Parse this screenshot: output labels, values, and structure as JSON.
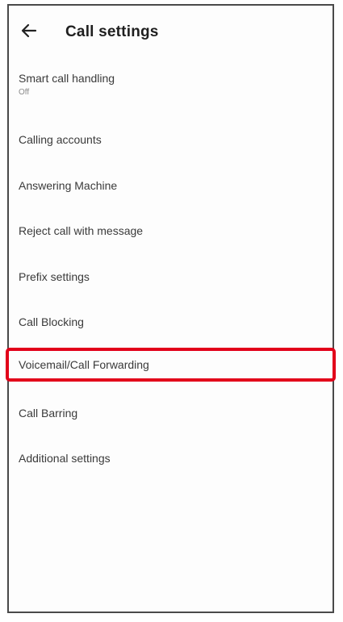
{
  "header": {
    "back_icon": "back-arrow-icon",
    "title": "Call settings"
  },
  "settings": {
    "items": [
      {
        "label": "Smart call handling",
        "sub": "Off"
      },
      {
        "label": "Calling accounts"
      },
      {
        "label": "Answering Machine"
      },
      {
        "label": "Reject call with message"
      },
      {
        "label": "Prefix settings"
      },
      {
        "label": "Call Blocking"
      },
      {
        "label": "Voicemail/Call Forwarding"
      },
      {
        "label": "Call Barring"
      },
      {
        "label": "Additional settings"
      }
    ],
    "highlight_color": "#e2001a"
  }
}
